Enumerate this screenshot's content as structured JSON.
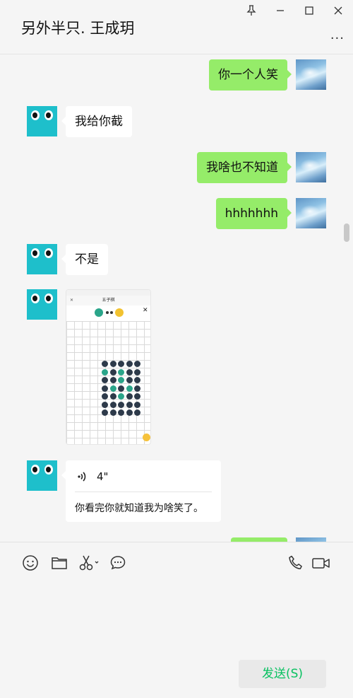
{
  "window": {
    "title": "另外半只. 王成玥",
    "more_label": "···"
  },
  "messages": [
    {
      "side": "right",
      "type": "text",
      "text": "你一个人笑"
    },
    {
      "side": "left",
      "type": "text",
      "text": "我给你截"
    },
    {
      "side": "right",
      "type": "text",
      "text": "我啥也不知道"
    },
    {
      "side": "right",
      "type": "text",
      "text": "hhhhhhh"
    },
    {
      "side": "left",
      "type": "text",
      "text": "不是"
    },
    {
      "side": "left",
      "type": "image",
      "image": {
        "app_title": "五子棋"
      }
    },
    {
      "side": "left",
      "type": "voice",
      "duration": "4\"",
      "transcript": "你看完你就知道我为啥笑了。"
    },
    {
      "side": "right",
      "type": "text",
      "text": ""
    }
  ],
  "toolbar": {
    "icons": [
      "emoji-icon",
      "folder-icon",
      "scissors-icon",
      "chat-history-icon",
      "phone-icon",
      "video-call-icon"
    ]
  },
  "input": {
    "send_label": "发送(S)"
  },
  "colors": {
    "accent_green": "#95ec69",
    "send_text": "#07c160",
    "avatar_teal": "#1ebfcb"
  }
}
